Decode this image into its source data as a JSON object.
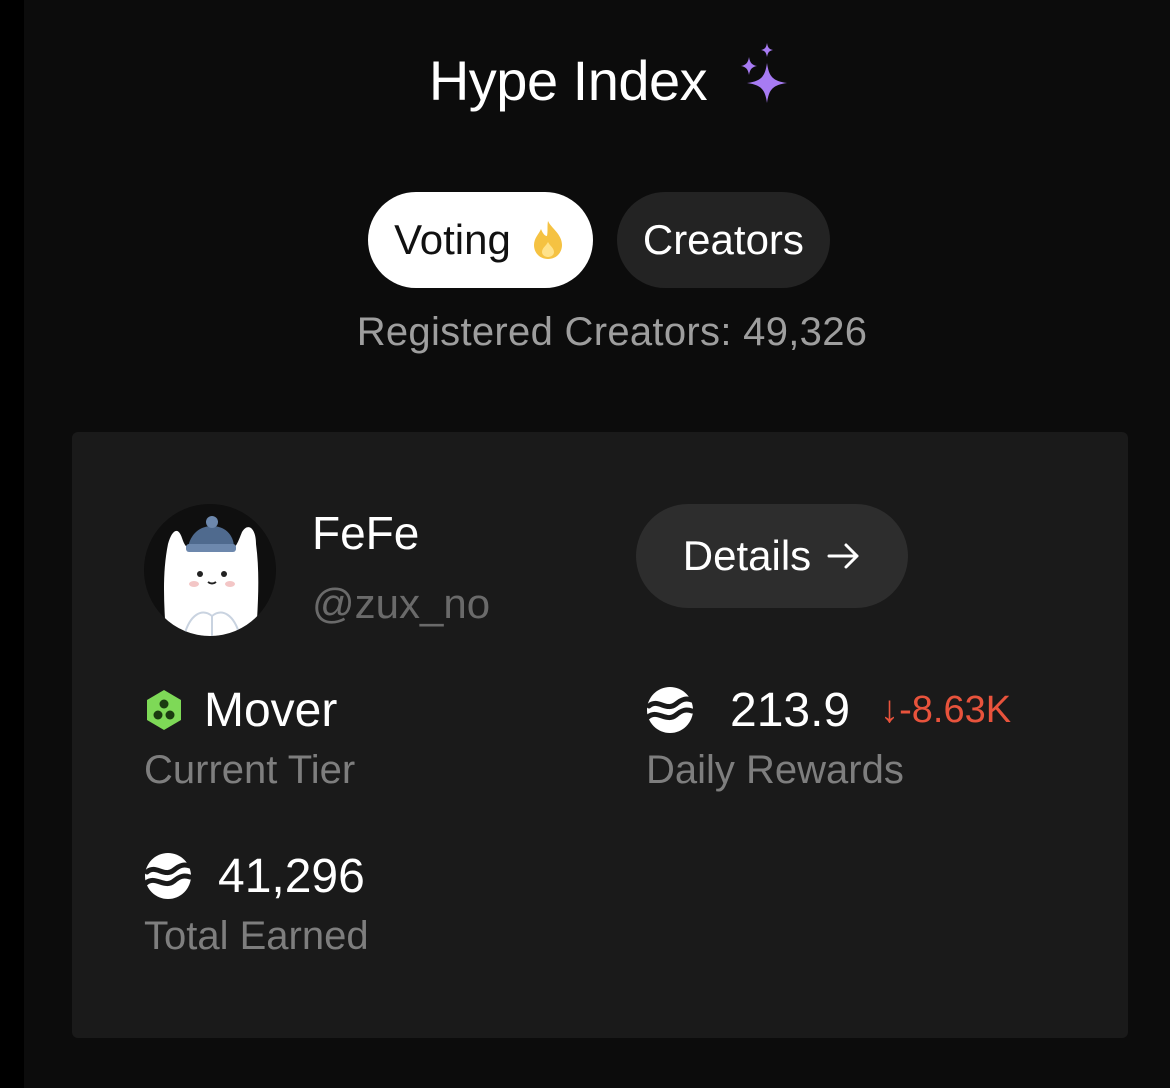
{
  "header": {
    "title": "Hype Index",
    "title_icon": "sparkles-icon"
  },
  "tabs": [
    {
      "label": "Voting",
      "icon": "flame-icon",
      "active": true
    },
    {
      "label": "Creators",
      "active": false
    }
  ],
  "registered_creators": "Registered Creators: 49,326",
  "creator_card": {
    "name": "FeFe",
    "handle": "@zux_no",
    "details_label": "Details",
    "details_icon": "arrow-right-icon",
    "tier": {
      "value": "Mover",
      "label": "Current Tier",
      "icon": "tier-badge-icon"
    },
    "daily_rewards": {
      "value": "213.9",
      "change_arrow": "↓",
      "change": "-8.63K",
      "label": "Daily Rewards",
      "icon": "token-icon"
    },
    "total_earned": {
      "value": "41,296",
      "label": "Total Earned",
      "icon": "token-icon"
    }
  },
  "colors": {
    "background": "#0c0c0c",
    "card": "#1a1a1a",
    "accent_purple": "#a77bf3",
    "flame_yellow": "#f5c242",
    "tier_green": "#7ed957",
    "negative": "#e8533c"
  }
}
